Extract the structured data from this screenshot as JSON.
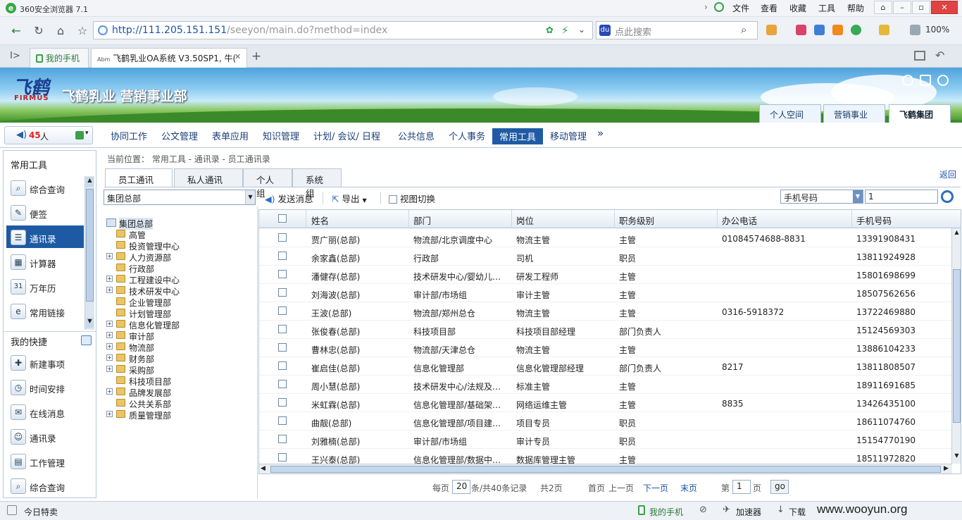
{
  "browser": {
    "title": "360安全浏览器 7.1",
    "menu": [
      "文件",
      "查看",
      "收藏",
      "工具",
      "帮助"
    ],
    "url_host": "http://111.205.151.151",
    "url_path": "/seeyon/main.do?method=index",
    "search_placeholder": "点此搜索",
    "zoom": "100%",
    "tabs": [
      {
        "label": "我的手机"
      },
      {
        "label": "飞鹤乳业OA系统 V3.50SP1, 牛(",
        "favicon": "Abm"
      }
    ],
    "new_tab": "+"
  },
  "banner": {
    "logo_text": "飞鹤",
    "logo_sub": "FIRMUS",
    "company": "飞鹤乳业 营销事业部",
    "spaces": [
      "个人空间",
      "营销事业部",
      "飞鹤集团"
    ]
  },
  "online": {
    "count": "45",
    "unit": "人"
  },
  "nav": {
    "items": [
      "协同工作",
      "公文管理",
      "表单应用",
      "知识管理",
      "计划/ 会议/ 日程",
      "公共信息",
      "个人事务",
      "常用工具",
      "移动管理"
    ],
    "more": "»"
  },
  "left": {
    "common_title": "常用工具",
    "common_items": [
      "综合查询",
      "便签",
      "通讯录",
      "计算器",
      "万年历",
      "常用链接"
    ],
    "shortcut_title": "我的快捷",
    "shortcut_items": [
      "新建事项",
      "时间安排",
      "在线消息",
      "通讯录",
      "工作管理",
      "综合查询"
    ]
  },
  "main": {
    "breadcrumb": "当前位置： 常用工具 - 通讯录 - 员工通讯录",
    "tabs": [
      "员工通讯录",
      "私人通讯录",
      "个人组",
      "系统组"
    ],
    "return_link": "返回",
    "org_select": "集团总部",
    "toolbar": {
      "send": "发送消息",
      "export": "导出",
      "switch": "视图切换"
    },
    "search_field": "手机号码",
    "search_value": "1"
  },
  "tree": {
    "root": "集团总部",
    "nodes": [
      {
        "label": "高管",
        "expandable": false
      },
      {
        "label": "投资管理中心",
        "expandable": false
      },
      {
        "label": "人力资源部",
        "expandable": true
      },
      {
        "label": "行政部",
        "expandable": false
      },
      {
        "label": "工程建设中心",
        "expandable": true
      },
      {
        "label": "技术研发中心",
        "expandable": true
      },
      {
        "label": "企业管理部",
        "expandable": false
      },
      {
        "label": "计划管理部",
        "expandable": false
      },
      {
        "label": "信息化管理部",
        "expandable": true
      },
      {
        "label": "审计部",
        "expandable": true
      },
      {
        "label": "物流部",
        "expandable": true
      },
      {
        "label": "财务部",
        "expandable": true
      },
      {
        "label": "采购部",
        "expandable": true
      },
      {
        "label": "科技项目部",
        "expandable": false
      },
      {
        "label": "品牌发展部",
        "expandable": true
      },
      {
        "label": "公共关系部",
        "expandable": false
      },
      {
        "label": "质量管理部",
        "expandable": true
      }
    ]
  },
  "grid": {
    "columns": [
      "姓名",
      "部门",
      "岗位",
      "职务级别",
      "办公电话",
      "手机号码"
    ],
    "rows": [
      [
        "贾广丽(总部)",
        "物流部/北京调度中心",
        "物流主管",
        "主管",
        "01084574688-8831",
        "13391908431"
      ],
      [
        "余家鑫(总部)",
        "行政部",
        "司机",
        "职员",
        "",
        "13811924928"
      ],
      [
        "潘健存(总部)",
        "技术研发中心/婴幼儿…",
        "研发工程师",
        "主管",
        "",
        "15801698699"
      ],
      [
        "刘海波(总部)",
        "审计部/市场组",
        "审计主管",
        "主管",
        "",
        "18507562656"
      ],
      [
        "王波(总部)",
        "物流部/郑州总仓",
        "物流主管",
        "主管",
        "0316-5918372",
        "13722469880"
      ],
      [
        "张俊春(总部)",
        "科技项目部",
        "科技项目部经理",
        "部门负责人",
        "",
        "15124569303"
      ],
      [
        "曹林忠(总部)",
        "物流部/天津总仓",
        "物流主管",
        "主管",
        "",
        "13886104233"
      ],
      [
        "崔启佳(总部)",
        "信息化管理部",
        "信息化管理部经理",
        "部门负责人",
        "8217",
        "13811808507"
      ],
      [
        "周小慧(总部)",
        "技术研发中心/法规及…",
        "标准主管",
        "主管",
        "",
        "18911691685"
      ],
      [
        "米虹霖(总部)",
        "信息化管理部/基础架…",
        "网络运维主管",
        "主管",
        "8835",
        "13426435100"
      ],
      [
        "曲靓(总部)",
        "信息化管理部/项目建…",
        "项目专员",
        "职员",
        "",
        "18611074760"
      ],
      [
        "刘雅楠(总部)",
        "审计部/市场组",
        "审计专员",
        "职员",
        "",
        "15154770190"
      ],
      [
        "王兴泰(总部)",
        "信息化管理部/数据中…",
        "数据库管理主管",
        "主管",
        "",
        "18511972820"
      ]
    ]
  },
  "pager": {
    "per_page_prefix": "每页",
    "per_page": "20",
    "total": "条/共40条记录",
    "pages": "共2页",
    "first": "首页",
    "prev": "上一页",
    "next": "下一页",
    "last": "末页",
    "page_prefix": "第",
    "page": "1",
    "page_suffix": "页",
    "go": "go"
  },
  "status": {
    "left": "今日特卖",
    "phone": "我的手机",
    "accel": "加速器",
    "download": "下载",
    "watermark": "www.wooyun.org"
  }
}
